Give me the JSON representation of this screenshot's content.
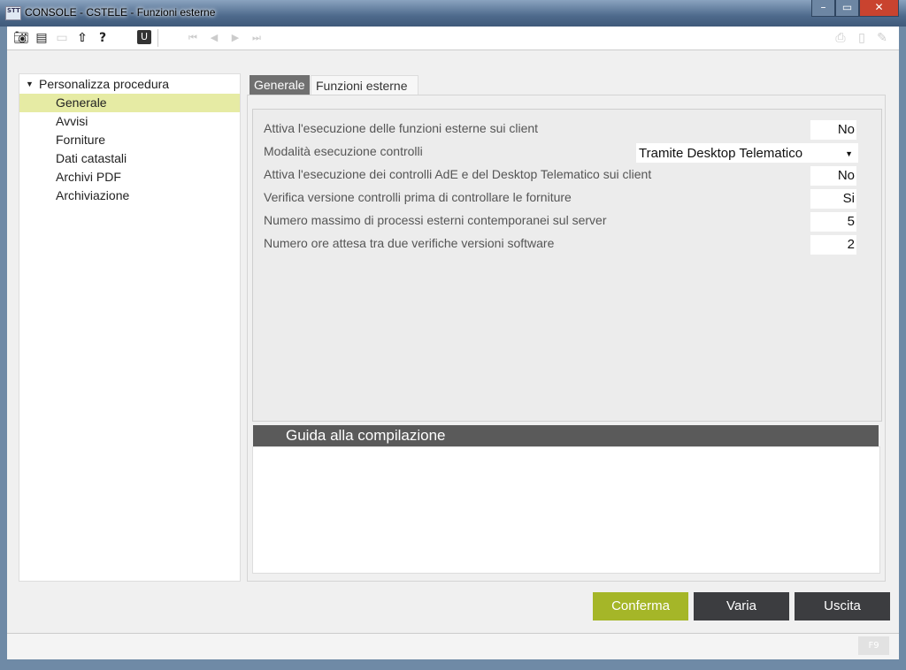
{
  "window": {
    "title": "CONSOLE  - CSTELE -  Funzioni esterne",
    "logo": "STT"
  },
  "toolbar": {
    "icons": [
      "camera-icon",
      "printer-icon",
      "folder-icon",
      "upload-icon",
      "help-icon",
      "u-icon",
      "first-icon",
      "prev-icon",
      "next-icon",
      "last-icon",
      "print-icon",
      "clipboard-icon",
      "pencil-icon"
    ]
  },
  "tree": {
    "root": "Personalizza procedura",
    "items": [
      {
        "label": "Generale",
        "selected": true
      },
      {
        "label": "Avvisi"
      },
      {
        "label": "Forniture"
      },
      {
        "label": "Dati catastali"
      },
      {
        "label": "Archivi PDF"
      },
      {
        "label": "Archiviazione"
      }
    ]
  },
  "tabs": [
    {
      "label": "Generale",
      "active": true
    },
    {
      "label": "Funzioni esterne"
    }
  ],
  "form": {
    "rows": [
      {
        "label": "Attiva l'esecuzione delle funzioni esterne sui client",
        "value": "No"
      },
      {
        "label": "Modalità esecuzione controlli",
        "value": "Tramite Desktop Telematico"
      },
      {
        "label": "Attiva l'esecuzione dei controlli AdE e del Desktop Telematico sui client",
        "value": "No"
      },
      {
        "label": "Verifica versione controlli prima di controllare le forniture",
        "value": "Si"
      },
      {
        "label": "Numero massimo di processi esterni contemporanei sul server",
        "value": "5"
      },
      {
        "label": "Numero ore attesa tra due verifiche versioni software",
        "value": "2"
      }
    ]
  },
  "guide": {
    "title": "Guida alla compilazione"
  },
  "buttons": {
    "confirm": "Conferma",
    "edit": "Varia",
    "exit": "Uscita"
  },
  "status": {
    "f9": "F9"
  },
  "colors": {
    "confirm": "#a5b628",
    "dark_button": "#3c3d40",
    "selection": "#e6eba4",
    "guide_header": "#5a5a5a"
  }
}
